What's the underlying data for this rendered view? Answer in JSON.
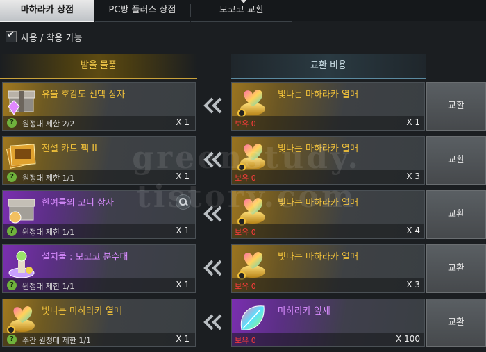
{
  "tabs": [
    {
      "label": "마하라카 상점",
      "active": true
    },
    {
      "label": "PC방 플러스 상점",
      "active": false
    },
    {
      "label": "모코코 교환",
      "active": false
    }
  ],
  "filter": {
    "label": "사용 / 착용 가능",
    "checked": true
  },
  "headers": {
    "receive": "받을 물품",
    "cost": "교환 비용"
  },
  "exchange_label": "교환",
  "rows": [
    {
      "item": {
        "name": "유물 호감도 선택 상자",
        "limit": "원정대 제한 2/2",
        "qty": "X 1",
        "icon": "relic-chest-icon",
        "grade": "gold"
      },
      "cost": {
        "name": "빛나는 마하라카 열매",
        "owned": "보유 0",
        "qty": "X 1",
        "icon": "glowing-maharaka-fruit-icon",
        "grade": "gold"
      }
    },
    {
      "item": {
        "name": "전설 카드 팩 II",
        "limit": "원정대 제한 1/1",
        "qty": "X 1",
        "icon": "legendary-card-pack-icon",
        "grade": "gold"
      },
      "cost": {
        "name": "빛나는 마하라카 열매",
        "owned": "보유 0",
        "qty": "X 3",
        "icon": "glowing-maharaka-fruit-icon",
        "grade": "gold"
      }
    },
    {
      "item": {
        "name": "한여름의 코니 상자",
        "limit": "원정대 제한 1/1",
        "qty": "X 1",
        "icon": "summer-coni-box-icon",
        "grade": "purple"
      },
      "cost": {
        "name": "빛나는 마하라카 열매",
        "owned": "보유 0",
        "qty": "X 4",
        "icon": "glowing-maharaka-fruit-icon",
        "grade": "gold"
      }
    },
    {
      "item": {
        "name": "설치물 : 모코코 분수대",
        "limit": "원정대 제한 1/1",
        "qty": "X 1",
        "icon": "mokoko-fountain-icon",
        "grade": "purple"
      },
      "cost": {
        "name": "빛나는 마하라카 열매",
        "owned": "보유 0",
        "qty": "X 3",
        "icon": "glowing-maharaka-fruit-icon",
        "grade": "gold"
      }
    },
    {
      "item": {
        "name": "빛나는 마하라카 열매",
        "limit": "주간 원정대 제한 1/1",
        "qty": "X 1",
        "icon": "glowing-maharaka-fruit-icon",
        "grade": "gold"
      },
      "cost": {
        "name": "마하라카 잎새",
        "owned": "보유 0",
        "qty": "X 100",
        "icon": "maharaka-leaf-icon",
        "grade": "purple"
      }
    }
  ],
  "watermark": [
    "greenstudy.",
    "tistory.com"
  ],
  "colors": {
    "gold_text": "#f2c23a",
    "purple_text": "#d98cff",
    "owned_red": "#ff3b3b",
    "limit_icon": "#6fb23c"
  }
}
